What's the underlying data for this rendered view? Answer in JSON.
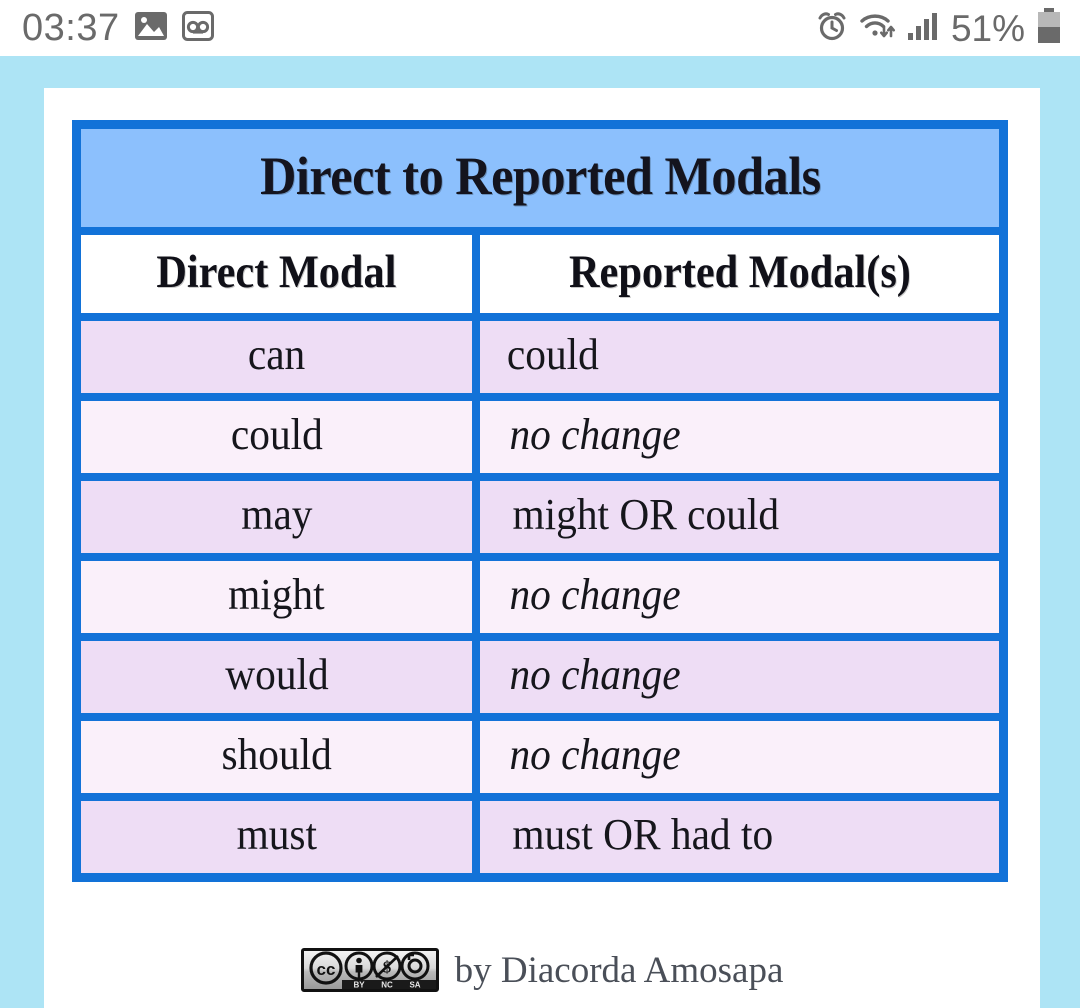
{
  "statusbar": {
    "time": "03:37",
    "battery_percent": "51%",
    "left_icons": [
      "gallery-icon",
      "voicemail-icon"
    ],
    "right_icons": [
      "alarm-icon",
      "wifi-icon",
      "cellular-signal-icon",
      "battery-icon"
    ]
  },
  "colors": {
    "page_background": "#ade4f5",
    "card_background": "#ffffff",
    "table_border": "#1272d8",
    "title_background": "#8cc0fd",
    "header_background": "#ffffff",
    "row_odd_background": "#eeddf5",
    "row_even_background": "#faf0fa",
    "text": "#16161c"
  },
  "table": {
    "title": "Direct to Reported Modals",
    "columns": [
      "Direct Modal",
      "Reported Modal(s)"
    ],
    "rows": [
      {
        "direct": "can",
        "reported": "could",
        "italic": false
      },
      {
        "direct": "could",
        "reported": "no change",
        "italic": true
      },
      {
        "direct": "may",
        "reported": "might OR could",
        "italic": false
      },
      {
        "direct": "might",
        "reported": "no change",
        "italic": true
      },
      {
        "direct": "would",
        "reported": "no change",
        "italic": true
      },
      {
        "direct": "should",
        "reported": "no change",
        "italic": true
      },
      {
        "direct": "must",
        "reported": "must OR had to",
        "italic": false
      }
    ]
  },
  "attribution": {
    "badge": "creative-commons-by-nc-sa-icon",
    "badge_labels": [
      "BY",
      "NC",
      "SA"
    ],
    "text": "by Diacorda Amosapa"
  }
}
